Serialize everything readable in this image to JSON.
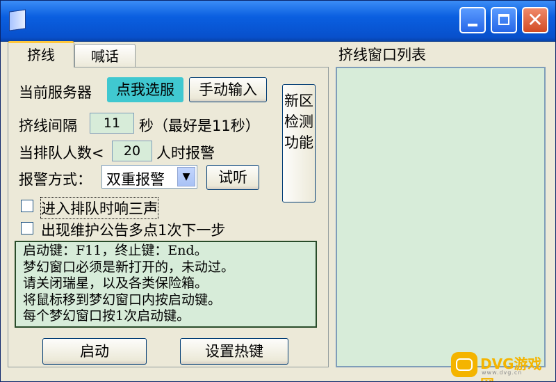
{
  "window": {
    "title": "",
    "controls": {
      "minimize": "minimize-icon",
      "maximize": "maximize-icon",
      "close": "close-icon"
    },
    "close_glyph": "✕"
  },
  "tabs": [
    {
      "label": "挤线",
      "active": true
    },
    {
      "label": "喊话",
      "active": false
    }
  ],
  "form": {
    "server_label": "当前服务器",
    "select_server_button": "点我选服",
    "manual_input_button": "手动输入",
    "interval_label": "挤线间隔",
    "interval_value": "11",
    "interval_unit": "秒（最好是11秒）",
    "queue_label": "当排队人数<",
    "queue_value": "20",
    "queue_suffix": "人时报警",
    "alarm_label": "报警方式：",
    "alarm_selected": "双重报警",
    "listen_button": "试听",
    "new_zone_button": "新区检测功能",
    "checkbox_queue_sound": {
      "label": "进入排队时响三声",
      "checked": false
    },
    "checkbox_maintenance": {
      "label": "出现维护公告多点1次下一步",
      "checked": false
    },
    "info_lines": [
      "启动键：F11，终止键：End。",
      "梦幻窗口必须是新打开的，未动过。",
      "请关闭瑞星，以及各类保险箱。",
      "将鼠标移到梦幻窗口内按启动键。",
      "每个梦幻窗口按1次启动键。"
    ],
    "start_button": "启动",
    "hotkey_button": "设置热键"
  },
  "right_panel": {
    "title": "挤线窗口列表",
    "items": []
  },
  "watermark": {
    "text": "DVG游戏网",
    "url": "www.dvg.cn"
  },
  "colors": {
    "titlebar": "#0a5fe0",
    "window_bg": "#ece9d8",
    "field_bg": "#d7ecd9",
    "accent_button": "#40c8d0",
    "watermark": "#f4b400"
  }
}
